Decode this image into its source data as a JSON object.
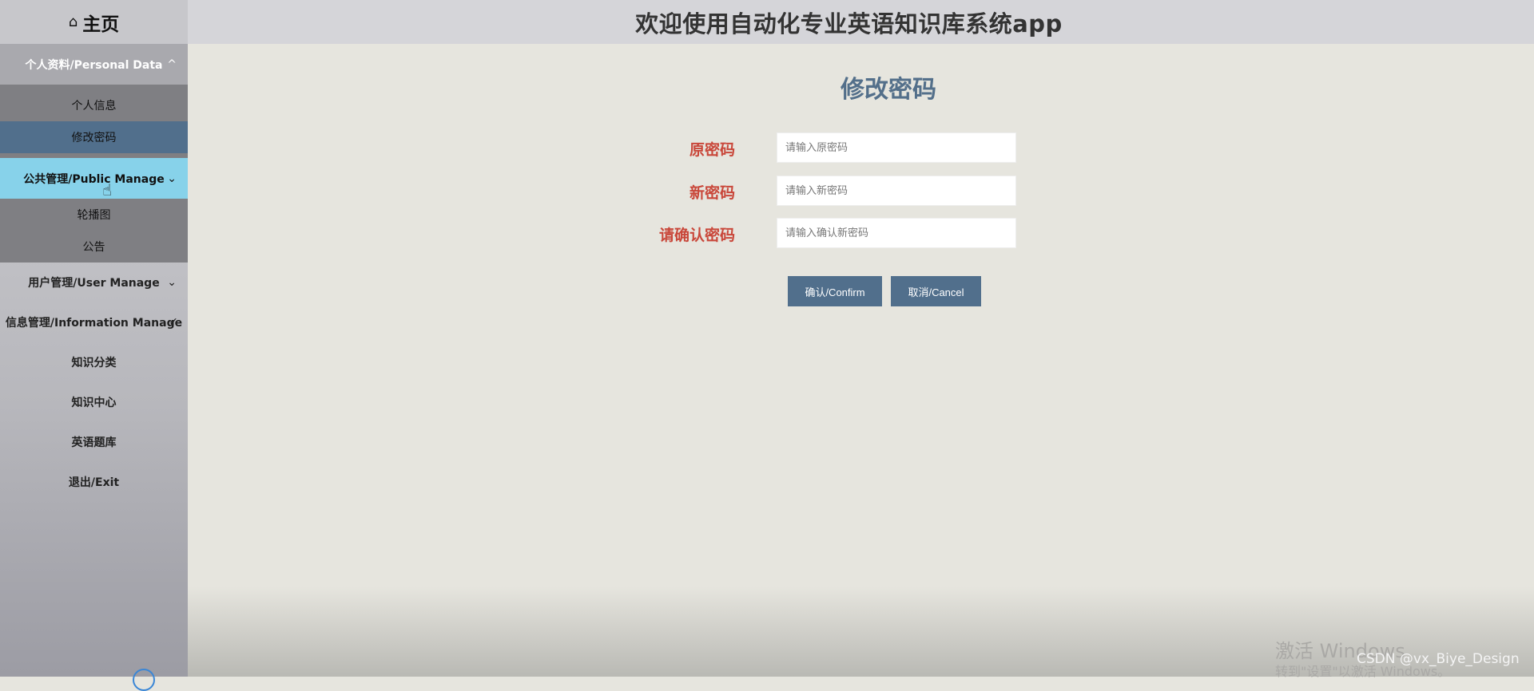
{
  "header": {
    "title": "欢迎使用自动化专业英语知识库系统app"
  },
  "sidebar": {
    "home": "主页",
    "sections": [
      {
        "label": "个人资料/Personal Data",
        "chevron": "^",
        "items": [
          "个人信息",
          "修改密码"
        ]
      },
      {
        "label": "公共管理/Public Manage",
        "chevron": "⌄",
        "items": [
          "轮播图",
          "公告"
        ]
      },
      {
        "label": "用户管理/User Manage",
        "chevron": "⌄"
      },
      {
        "label": "信息管理/Information Manage",
        "chevron": "✓"
      }
    ],
    "items": [
      "知识分类",
      "知识中心",
      "英语题库",
      "退出/Exit"
    ]
  },
  "form": {
    "title": "修改密码",
    "fields": [
      {
        "label": "原密码",
        "placeholder": "请输入原密码"
      },
      {
        "label": "新密码",
        "placeholder": "请输入新密码"
      },
      {
        "label": "请确认密码",
        "placeholder": "请输入确认新密码"
      }
    ],
    "confirm": "确认/Confirm",
    "cancel": "取消/Cancel"
  },
  "overlay": {
    "watermark_line1": "激活 Windows",
    "watermark_line2": "转到\"设置\"以激活 Windows。",
    "csdn": "CSDN @vx_Biye_Design"
  },
  "colors": {
    "accent": "#516f8c",
    "active_menu": "#87d2ea",
    "label_red": "#c9473a"
  },
  "icons": {
    "home": "home-icon",
    "pointer": "hand-cursor-icon"
  }
}
